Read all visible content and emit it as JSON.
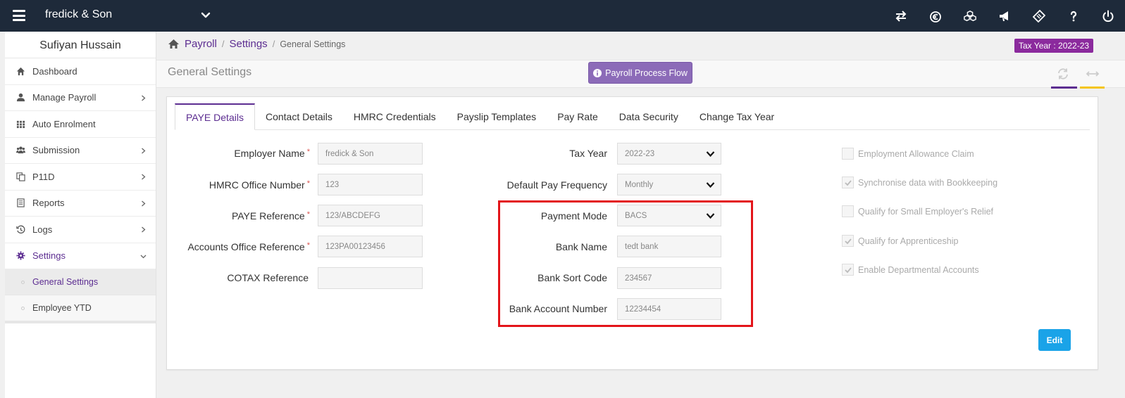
{
  "topbar": {
    "company": "fredick & Son",
    "icons": [
      "swap-icon",
      "currency-icon",
      "cubes-icon",
      "megaphone-icon",
      "ticket-icon",
      "help-icon",
      "power-icon"
    ]
  },
  "sidebar": {
    "user_name": "Sufiyan Hussain",
    "items": [
      {
        "label": "Dashboard",
        "icon": "home-icon"
      },
      {
        "label": "Manage Payroll",
        "icon": "user-icon"
      },
      {
        "label": "Auto Enrolment",
        "icon": "grid-icon"
      },
      {
        "label": "Submission",
        "icon": "users-icon"
      },
      {
        "label": "P11D",
        "icon": "copy-icon"
      },
      {
        "label": "Reports",
        "icon": "document-icon"
      },
      {
        "label": "Logs",
        "icon": "history-icon"
      },
      {
        "label": "Settings",
        "icon": "gear-icon"
      }
    ],
    "sub_items": [
      {
        "label": "General Settings"
      },
      {
        "label": "Employee YTD"
      }
    ]
  },
  "breadcrumb": {
    "payroll": "Payroll",
    "settings": "Settings",
    "current": "General Settings",
    "sep": "/"
  },
  "tax_year_badge": "Tax Year : 2022-23",
  "page_title": "General Settings",
  "flow_button": "Payroll Process Flow",
  "tabs": [
    "PAYE Details",
    "Contact Details",
    "HMRC Credentials",
    "Payslip Templates",
    "Pay Rate",
    "Data Security",
    "Change Tax Year"
  ],
  "form": {
    "employer_name": {
      "label": "Employer Name",
      "value": "fredick & Son"
    },
    "hmrc_office_number": {
      "label": "HMRC Office Number",
      "value": "123"
    },
    "paye_reference": {
      "label": "PAYE Reference",
      "value": "123/ABCDEFG"
    },
    "accounts_office_reference": {
      "label": "Accounts Office Reference",
      "value": "123PA00123456"
    },
    "cotax_reference": {
      "label": "COTAX Reference",
      "value": ""
    },
    "tax_year": {
      "label": "Tax Year",
      "value": "2022-23"
    },
    "default_pay_frequency": {
      "label": "Default Pay Frequency",
      "value": "Monthly"
    },
    "payment_mode": {
      "label": "Payment Mode",
      "value": "BACS"
    },
    "bank_name": {
      "label": "Bank Name",
      "value": "tedt bank"
    },
    "bank_sort_code": {
      "label": "Bank Sort Code",
      "value": "234567"
    },
    "bank_account_number": {
      "label": "Bank Account Number",
      "value": "12234454"
    },
    "required_mark": "*"
  },
  "checkboxes": [
    {
      "label": "Employment Allowance Claim",
      "checked": false
    },
    {
      "label": "Synchronise data with Bookkeeping",
      "checked": true
    },
    {
      "label": "Qualify for Small Employer's Relief",
      "checked": false
    },
    {
      "label": "Qualify for Apprenticeship",
      "checked": true
    },
    {
      "label": "Enable Departmental Accounts",
      "checked": true
    }
  ],
  "edit_button": "Edit",
  "colors": {
    "topbar": "#1e2a3a",
    "brand_purple": "#5c2d91",
    "tax_badge": "#8b2a9d",
    "flow_button": "#8c6bb8",
    "highlight": "#e3151a",
    "edit_button": "#1aa3e8"
  }
}
